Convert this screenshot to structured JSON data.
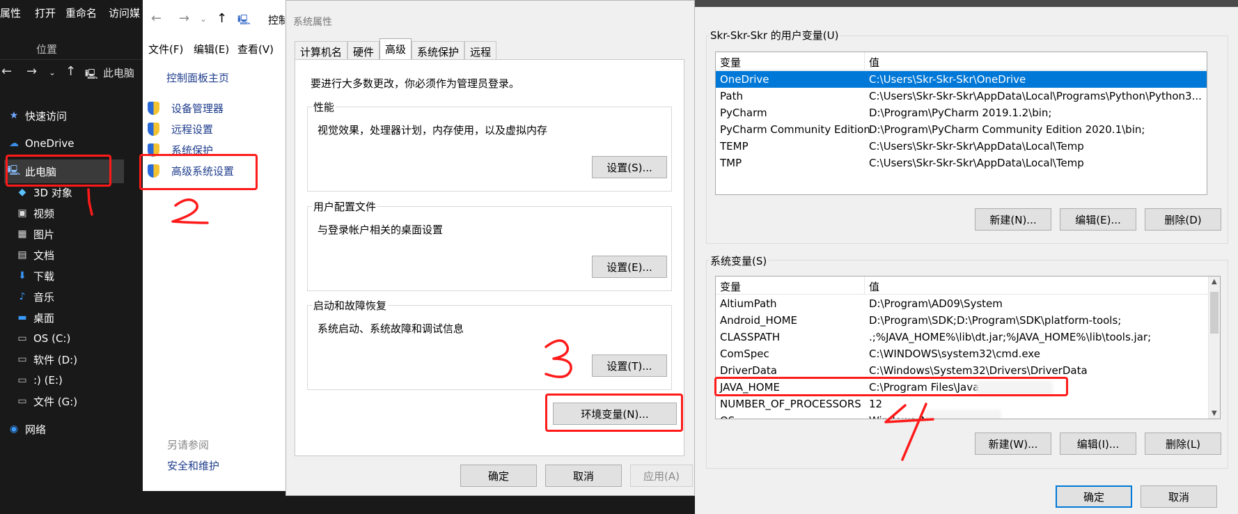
{
  "explorer": {
    "ribbon": [
      "属性",
      "打开",
      "重命名",
      "访问媒"
    ],
    "ribbon_group": "位置",
    "nav_location": "此电脑",
    "sidebar": [
      {
        "label": "快速访问",
        "icon": "star-icon"
      },
      {
        "label": "OneDrive",
        "icon": "cloud-icon"
      },
      {
        "label": "此电脑",
        "icon": "computer-icon"
      },
      {
        "label": "3D 对象",
        "icon": "cube-icon"
      },
      {
        "label": "视频",
        "icon": "video-icon"
      },
      {
        "label": "图片",
        "icon": "picture-icon"
      },
      {
        "label": "文档",
        "icon": "document-icon"
      },
      {
        "label": "下载",
        "icon": "download-icon"
      },
      {
        "label": "音乐",
        "icon": "music-icon"
      },
      {
        "label": "桌面",
        "icon": "desktop-icon"
      },
      {
        "label": "OS (C:)",
        "icon": "drive-icon"
      },
      {
        "label": "软件 (D:)",
        "icon": "drive-icon"
      },
      {
        "label": ":) (E:)",
        "icon": "drive-icon"
      },
      {
        "label": "文件 (G:)",
        "icon": "drive-icon"
      },
      {
        "label": "网络",
        "icon": "network-icon"
      }
    ]
  },
  "control_panel": {
    "address": "控制",
    "menu": [
      "文件(F)",
      "编辑(E)",
      "查看(V)"
    ],
    "home_link": "控制面板主页",
    "links": [
      "设备管理器",
      "远程设置",
      "系统保护",
      "高级系统设置"
    ],
    "see_also": "另请参阅",
    "security_link": "安全和维护"
  },
  "system_properties": {
    "title": "系统属性",
    "tabs": [
      "计算机名",
      "硬件",
      "高级",
      "系统保护",
      "远程"
    ],
    "active_tab": "高级",
    "admin_notice": "要进行大多数更改，你必须作为管理员登录。",
    "groups": [
      {
        "title": "性能",
        "desc": "视觉效果，处理器计划，内存使用，以及虚拟内存",
        "button": "设置(S)..."
      },
      {
        "title": "用户配置文件",
        "desc": "与登录帐户相关的桌面设置",
        "button": "设置(E)..."
      },
      {
        "title": "启动和故障恢复",
        "desc": "系统启动、系统故障和调试信息",
        "button": "设置(T)..."
      }
    ],
    "env_button": "环境变量(N)...",
    "ok": "确定",
    "cancel": "取消",
    "apply": "应用(A)"
  },
  "env_vars": {
    "user_group_title": "Skr-Skr-Skr 的用户变量(U)",
    "col_var": "变量",
    "col_val": "值",
    "user_vars": [
      {
        "name": "OneDrive",
        "value": "C:\\Users\\Skr-Skr-Skr\\OneDrive"
      },
      {
        "name": "Path",
        "value": "C:\\Users\\Skr-Skr-Skr\\AppData\\Local\\Programs\\Python\\Python3..."
      },
      {
        "name": "PyCharm",
        "value": "D:\\Program\\PyCharm 2019.1.2\\bin;"
      },
      {
        "name": "PyCharm Community Edition",
        "value": "D:\\Program\\PyCharm Community Edition 2020.1\\bin;"
      },
      {
        "name": "TEMP",
        "value": "C:\\Users\\Skr-Skr-Skr\\AppData\\Local\\Temp"
      },
      {
        "name": "TMP",
        "value": "C:\\Users\\Skr-Skr-Skr\\AppData\\Local\\Temp"
      }
    ],
    "user_buttons": [
      "新建(N)...",
      "编辑(E)...",
      "删除(D)"
    ],
    "system_group_title": "系统变量(S)",
    "system_vars": [
      {
        "name": "AltiumPath",
        "value": "D:\\Program\\AD09\\System"
      },
      {
        "name": "Android_HOME",
        "value": "D:\\Program\\SDK;D:\\Program\\SDK\\platform-tools;"
      },
      {
        "name": "CLASSPATH",
        "value": ".;%JAVA_HOME%\\lib\\dt.jar;%JAVA_HOME%\\lib\\tools.jar;"
      },
      {
        "name": "ComSpec",
        "value": "C:\\WINDOWS\\system32\\cmd.exe"
      },
      {
        "name": "DriverData",
        "value": "C:\\Windows\\System32\\Drivers\\DriverData"
      },
      {
        "name": "JAVA_HOME",
        "value": "C:\\Program Files\\Java"
      },
      {
        "name": "NUMBER_OF_PROCESSORS",
        "value": "12"
      },
      {
        "name": "OS",
        "value": "Windows_NT"
      }
    ],
    "system_buttons": [
      "新建(W)...",
      "编辑(I)...",
      "删除(L)"
    ],
    "ok": "确定",
    "cancel": "取消"
  },
  "annotation_color": "#ff1a1a"
}
